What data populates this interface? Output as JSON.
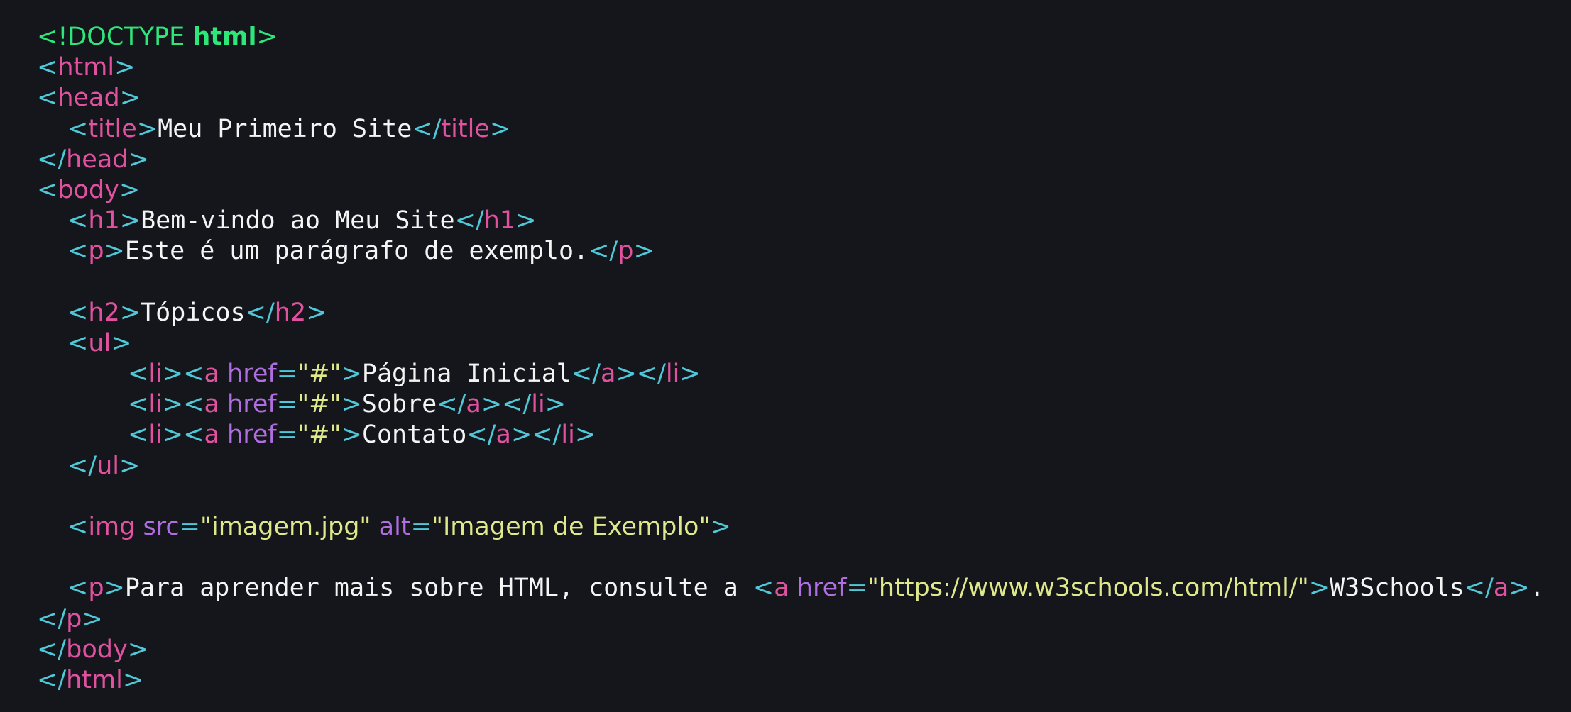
{
  "editor": {
    "theme_colors": {
      "background": "#15161c",
      "bracket": "#4fc8d8",
      "tag": "#e052a0",
      "attribute": "#b06ee0",
      "string": "#dfe88a",
      "doctype": "#2ee77a",
      "text": "#f2f2f2"
    },
    "lines": {
      "l1": {
        "open": "<!DOCTYPE ",
        "kw": "html",
        "close": ">"
      },
      "l2": {
        "lt": "<",
        "tag": "html",
        "gt": ">"
      },
      "l3": {
        "lt": "<",
        "tag": "head",
        "gt": ">"
      },
      "l4": {
        "lt": "<",
        "tag": "title",
        "gt": ">",
        "text": "Meu Primeiro Site",
        "lt2": "</",
        "tag2": "title",
        "gt2": ">"
      },
      "l5": {
        "lt": "</",
        "tag": "head",
        "gt": ">"
      },
      "l6": {
        "lt": "<",
        "tag": "body",
        "gt": ">"
      },
      "l7": {
        "lt": "<",
        "tag": "h1",
        "gt": ">",
        "text": "Bem-vindo ao Meu Site",
        "lt2": "</",
        "tag2": "h1",
        "gt2": ">"
      },
      "l8": {
        "lt": "<",
        "tag": "p",
        "gt": ">",
        "text": "Este é um parágrafo de exemplo.",
        "lt2": "</",
        "tag2": "p",
        "gt2": ">"
      },
      "l9": {
        "lt": "<",
        "tag": "h2",
        "gt": ">",
        "text": "Tópicos",
        "lt2": "</",
        "tag2": "h2",
        "gt2": ">"
      },
      "l10": {
        "lt": "<",
        "tag": "ul",
        "gt": ">"
      },
      "l11": {
        "lt": "<",
        "tag": "li",
        "gt": ">",
        "lt_a": "<",
        "tag_a": "a",
        "attr": " href",
        "eq": "=",
        "val": "\"#\"",
        "gt_a": ">",
        "text": "Página Inicial",
        "lt2": "</",
        "tag2": "a",
        "gt2": ">",
        "lt3": "</",
        "tag3": "li",
        "gt3": ">"
      },
      "l12": {
        "lt": "<",
        "tag": "li",
        "gt": ">",
        "lt_a": "<",
        "tag_a": "a",
        "attr": " href",
        "eq": "=",
        "val": "\"#\"",
        "gt_a": ">",
        "text": "Sobre",
        "lt2": "</",
        "tag2": "a",
        "gt2": ">",
        "lt3": "</",
        "tag3": "li",
        "gt3": ">"
      },
      "l13": {
        "lt": "<",
        "tag": "li",
        "gt": ">",
        "lt_a": "<",
        "tag_a": "a",
        "attr": " href",
        "eq": "=",
        "val": "\"#\"",
        "gt_a": ">",
        "text": "Contato",
        "lt2": "</",
        "tag2": "a",
        "gt2": ">",
        "lt3": "</",
        "tag3": "li",
        "gt3": ">"
      },
      "l14": {
        "lt": "</",
        "tag": "ul",
        "gt": ">"
      },
      "l15": {
        "lt": "<",
        "tag": "img",
        "attr1": " src",
        "eq1": "=",
        "val1": "\"imagem.jpg\"",
        "attr2": " alt",
        "eq2": "=",
        "val2": "\"Imagem de Exemplo\"",
        "gt": ">"
      },
      "l16": {
        "lt": "<",
        "tag": "p",
        "gt": ">",
        "text": "Para aprender mais sobre HTML, consulte a ",
        "lt_a": "<",
        "tag_a": "a",
        "attr": " href",
        "eq": "=",
        "val": "\"https://www.w3schools.com/html/\"",
        "gt_a": ">",
        "text2": "W3Schools",
        "lt2": "</",
        "tag2": "a",
        "gt2": ">",
        "text3": "."
      },
      "l17": {
        "lt": "</",
        "tag": "p",
        "gt": ">"
      },
      "l18": {
        "lt": "</",
        "tag": "body",
        "gt": ">"
      },
      "l19": {
        "lt": "</",
        "tag": "html",
        "gt": ">"
      }
    }
  }
}
